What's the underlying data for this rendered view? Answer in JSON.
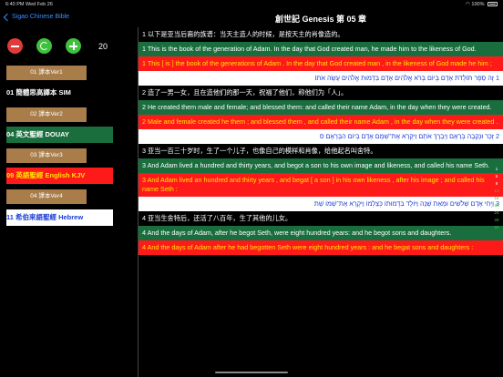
{
  "status": {
    "time_date": "6:40 PM   Wed Feb 26",
    "battery": "100%"
  },
  "nav": {
    "back_label": "Sigao Chinese Bible",
    "title": "創世記 Genesis 第 05 章"
  },
  "sidebar": {
    "count": "20",
    "versions": [
      {
        "button": "01 譯本Ver1",
        "name": "01 簡體思高譯本 SIM"
      },
      {
        "button": "02 譯本Ver2",
        "name": "04 英文聖經 DOUAY"
      },
      {
        "button": "03 譯本Ver3",
        "name": "09 英語聖經 English KJV"
      },
      {
        "button": "04 譯本Ver4",
        "name": "11 希伯來語聖經 Hebrew"
      }
    ]
  },
  "verses": [
    {
      "cn": "1 以下是亚当后裔的族谱：当天主造人的时候，是按天主的肖像造的。",
      "douay": "1 This is the book of the generation of Adam. In the day that God created man, he made him to the likeness of God.",
      "kjv": "1 This [ is ] the book of the generations of Adam . In the day that God created man , in the likeness of God made he him ;",
      "heb": "1 זֶה סֵפֶר תּוֹלְדֹת אָדָם בְּיוֹם בְּרֹא אֱלֹהִים אָדָם בִּדְמוּת אֱלֹהִים עָשָׂה אֹתוֹ׃"
    },
    {
      "cn": "2 造了一男一女，且在造他们的那一天，祝福了他们，称他们为「人」。",
      "douay": "2 He created them male and female; and blessed them: and called their name Adam, in the day when they were created.",
      "kjv": "2 Male and female created he them ; and blessed them , and called their name Adam , in the day when they were created .",
      "heb": "2 זָכָר וּנְקֵבָה בְּרָאָם וַיְבָרֶךְ אֹתָם וַיִּקְרָא אֶת־שְׁמָם אָדָם בְּיוֹם הִבָּרְאָם׃ ס"
    },
    {
      "cn": "3 亚当一百三十岁时，生了一个儿子，也像自己的模样和肖像，给他起名叫舍特。",
      "douay": "3 And Adam lived a hundred and thirty years, and begot a son to his own image and likeness, and called his name Seth.",
      "kjv": "3 And Adam lived an hundred and thirty years , and begat [ a son ] in his own likeness , after his image ; and called his name Seth :",
      "heb": "3 וַיְחִי אָדָם שְׁלֹשִׁים וּמְאַת שָׁנָה וַיּוֹלֶד בִּדְמוּתוֹ כְּצַלְמוֹ וַיִּקְרָא אֶת־שְׁמוֹ שֵׁת׃"
    },
    {
      "cn": "4 亚当生舍特后，还活了八百年，生了其他的儿女。",
      "douay": "4 And the days of Adam, after he begot Seth, were eight hundred years: and he begot sons and daughters.",
      "kjv": "4 And the days of Adam after he had begotten Seth were eight hundred years : and he begat sons and daughters :",
      "heb": ""
    }
  ],
  "scroll_index": [
    "1",
    "5",
    "9",
    "13",
    "16",
    "20",
    "24",
    "28",
    "31"
  ]
}
